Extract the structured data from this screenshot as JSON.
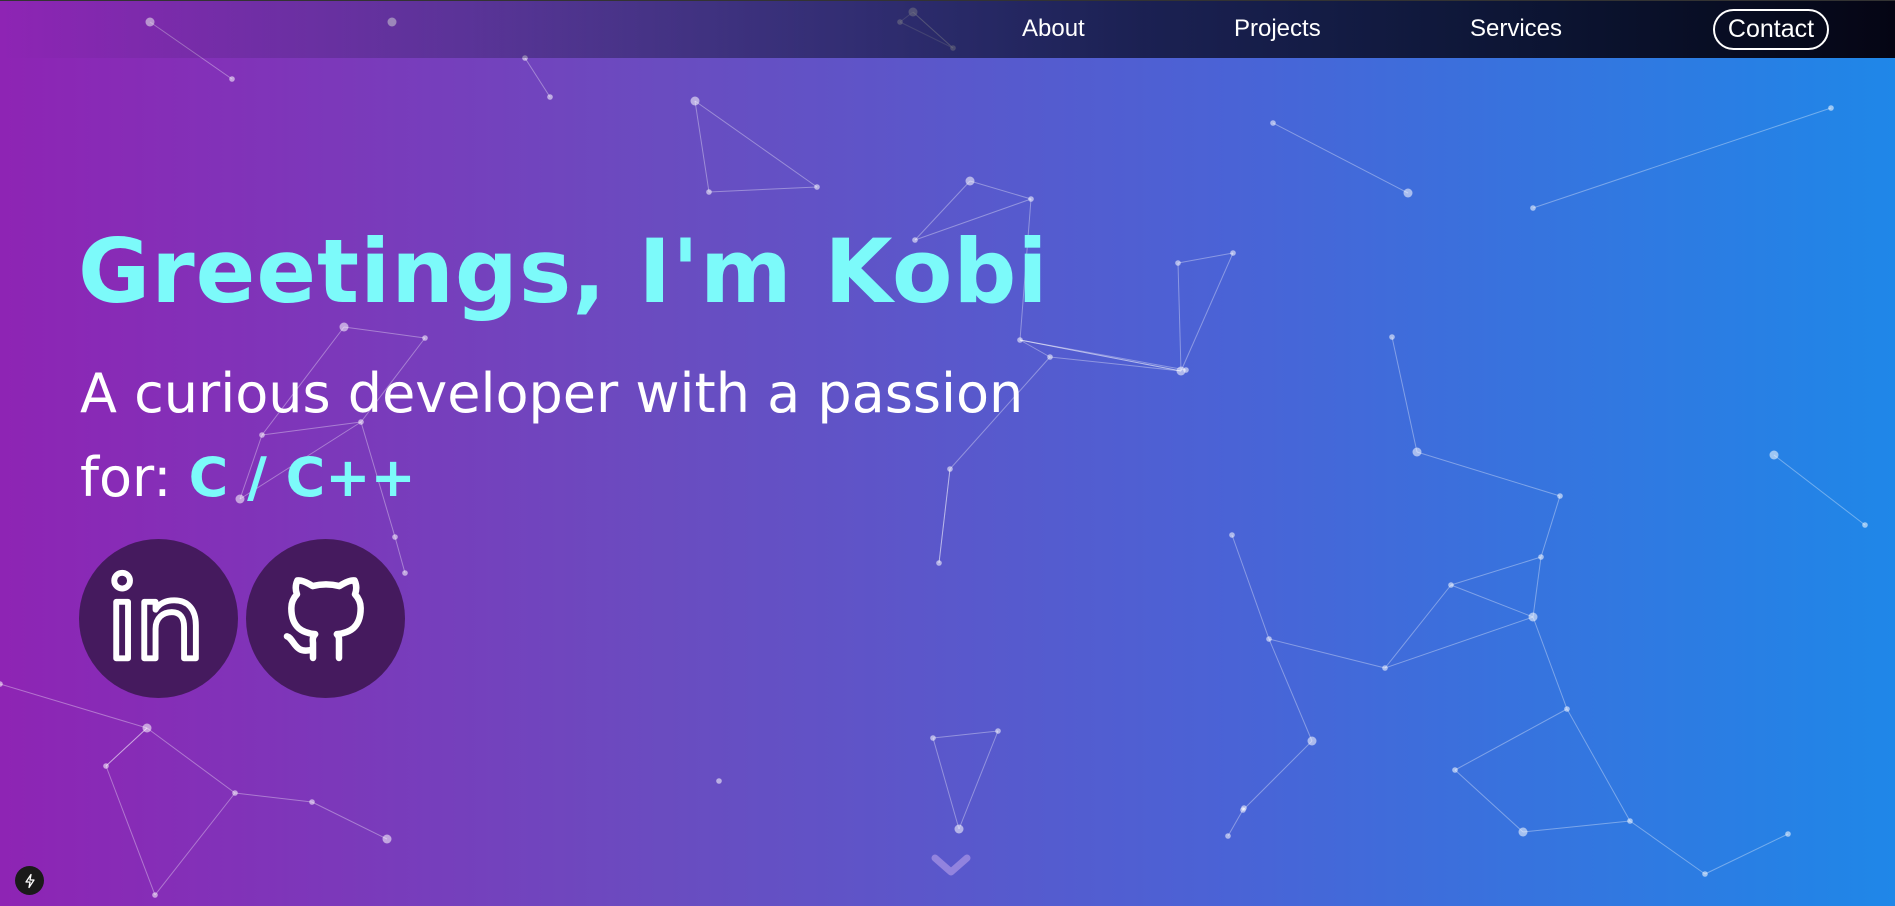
{
  "nav": {
    "items": [
      {
        "label": "About"
      },
      {
        "label": "Projects"
      },
      {
        "label": "Services"
      }
    ],
    "contact_label": "Contact"
  },
  "hero": {
    "title": "Greetings, I'm Kobi",
    "subtitle_line1": "A curious developer with a passion",
    "subtitle_prefix": "for:",
    "subtitle_highlight": "C / C++"
  },
  "social": [
    {
      "icon": "linkedin-icon"
    },
    {
      "icon": "github-icon"
    }
  ],
  "colors": {
    "accent": "#7cfafa",
    "gradient_start": "#8e24b4",
    "gradient_end": "#1f87e8",
    "social_bg": "#451a5e"
  },
  "icons": {
    "scroll": "chevron-down-icon",
    "dev_badge": "lightning-icon"
  }
}
